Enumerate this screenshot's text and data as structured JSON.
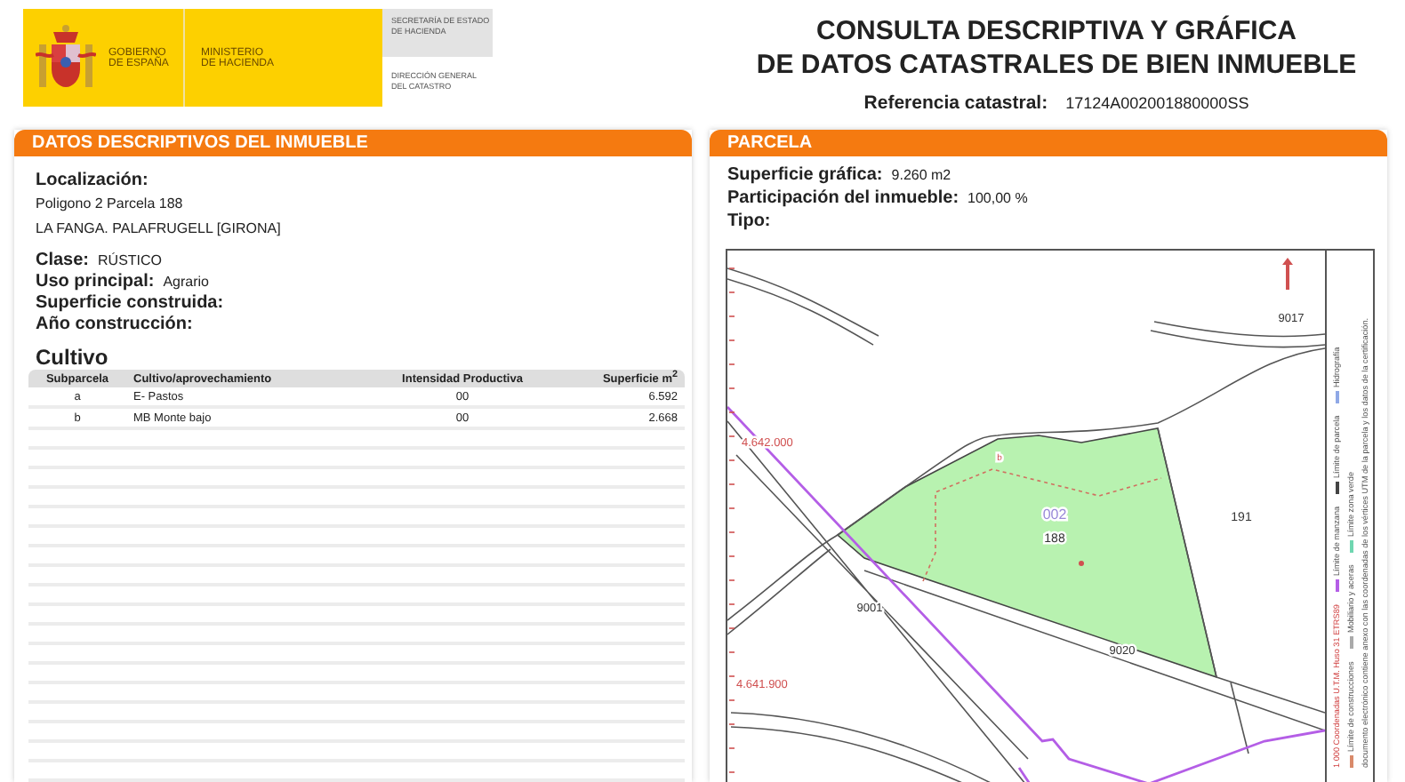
{
  "header": {
    "government": [
      "GOBIERNO",
      "DE ESPAÑA"
    ],
    "ministry": [
      "MINISTERIO",
      "DE HACIENDA"
    ],
    "secretariat": [
      "SECRETARÍA DE ESTADO",
      "DE HACIENDA"
    ],
    "directorate": [
      "DIRECCIÓN GENERAL",
      "DEL CATASTRO"
    ]
  },
  "title": [
    "CONSULTA DESCRIPTIVA Y GRÁFICA",
    "DE DATOS CATASTRALES DE BIEN INMUEBLE"
  ],
  "reference": {
    "label": "Referencia catastral:",
    "value": "17124A002001880000SS"
  },
  "descriptive": {
    "heading": "DATOS DESCRIPTIVOS DEL **INMUEBLE**",
    "location_label": "Localización:",
    "location_lines": [
      "Poligono 2 Parcela 188",
      "LA FANGA. PALAFRUGELL [GIRONA]"
    ],
    "fields": [
      {
        "label": "Clase:",
        "value": "RÚSTICO"
      },
      {
        "label": "Uso principal:",
        "value": "Agrario"
      },
      {
        "label": "Superficie construida:"
      },
      {
        "label": "Año construcción:"
      }
    ]
  },
  "cultivo": {
    "title": "Cultivo",
    "columns": [
      "Subparcela",
      "Cultivo/aprovechamiento",
      "Intensidad Productiva",
      "Superficie m$^{2}$"
    ],
    "rows": [
      [
        "a",
        "E- Pastos",
        "00",
        "6.592"
      ],
      [
        "b",
        "MB Monte bajo",
        "00",
        "2.668"
      ]
    ]
  },
  "parcela": {
    "heading": "PARCELA",
    "fields": [
      {
        "label": "Superficie gráfica:",
        "value": "9.260 m2"
      },
      {
        "label": "Participación del inmueble:",
        "value": "100,00 %"
      },
      {
        "label": "Tipo:"
      }
    ]
  },
  "map": {
    "labels": [
      {
        "kind": "coordinate",
        "text": "4.642.000"
      },
      {
        "kind": "coordinate",
        "text": "4.641.900"
      },
      {
        "kind": "polygon",
        "text": "002"
      },
      {
        "kind": "parcel",
        "text": "188"
      },
      {
        "kind": "parcel",
        "text": "191"
      },
      {
        "kind": "road",
        "text": "9001"
      },
      {
        "kind": "road",
        "text": "9020"
      },
      {
        "kind": "road",
        "text": "9017"
      },
      {
        "kind": "subparcel",
        "text": "b"
      }
    ],
    "scale": "1 000 Coordenadas U.T.M. Huso 31 ETRS89",
    "legend_columns": [
      [
        {
          "label": "Límite de manzana",
          "color": "#b45ee6"
        },
        {
          "label": "Límite de parcela",
          "color": "#444444"
        },
        {
          "label": "Hidrografía",
          "color": "#8fa8e6"
        }
      ],
      [
        {
          "label": "Límite de construcciones",
          "color": "#d98a6a"
        },
        {
          "label": "Mobiliario y aceras",
          "color": "#aaaaaa"
        },
        {
          "label": "Límite zona verde",
          "color": "#6fd6b0"
        }
      ]
    ],
    "note": "documento electrónico contiene anexo con las coordenadas de los vértices UTM de la parcela y los datos de la certificación."
  }
}
